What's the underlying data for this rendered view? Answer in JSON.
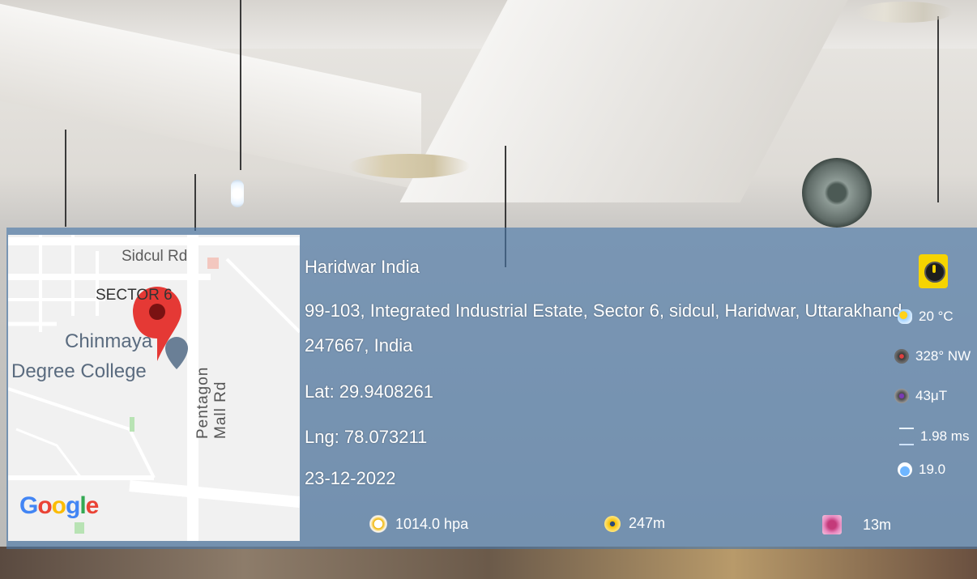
{
  "map": {
    "road_label_1": "Sidcul Rd",
    "area_label": "SECTOR 6",
    "road_label_2": "Pentagon Mall Rd",
    "place_line_1": "Chinmaya",
    "place_line_2": "Degree College",
    "provider": [
      "G",
      "o",
      "o",
      "g",
      "l",
      "e"
    ],
    "pin_icon": "map-pin-icon",
    "place_icon": "graduation-cap-icon",
    "pin_color": "#e53935"
  },
  "location": {
    "city": "Haridwar India",
    "address_line_1": "99-103, Integrated Industrial Estate, Sector 6, sidcul, Haridwar, Uttarakhand",
    "address_line_2": "247667, India",
    "latitude": "Lat: 29.9408261",
    "longitude": "Lng: 78.073211",
    "date": "23-12-2022"
  },
  "stats": {
    "pressure": "1014.0 hpa",
    "altitude": "247m",
    "accuracy": "13m"
  },
  "weather": {
    "temperature": "20 °C",
    "wind_direction": "328° NW",
    "magnetic_field": "43μT",
    "wind_speed": "1.98 ms",
    "humidity": "19.0"
  },
  "colors": {
    "overlay": "#4878aa",
    "text": "#ffffff",
    "badge": "#f6d400"
  }
}
